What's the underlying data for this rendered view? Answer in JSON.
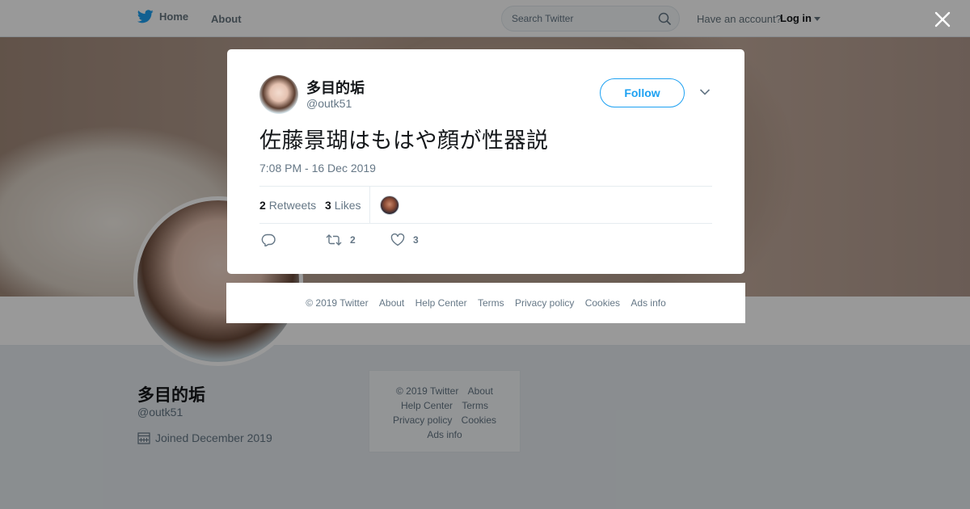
{
  "topbar": {
    "home_label": "Home",
    "about_label": "About",
    "search_placeholder": "Search Twitter",
    "have_account": "Have an account?",
    "login_label": "Log in"
  },
  "profile": {
    "name": "多目的垢",
    "handle": "@outk51",
    "joined": "Joined December 2019"
  },
  "side_footer": {
    "rows": [
      [
        "© 2019 Twitter",
        "About"
      ],
      [
        "Help Center",
        "Terms"
      ],
      [
        "Privacy policy",
        "Cookies"
      ],
      [
        "Ads info"
      ]
    ]
  },
  "tweet": {
    "name": "多目的垢",
    "handle": "@outk51",
    "follow_label": "Follow",
    "text": "佐藤景瑚はもはや顔が性器説",
    "time": "7:08 PM - 16 Dec 2019",
    "retweets_count": "2",
    "retweets_label": "Retweets",
    "likes_count": "3",
    "likes_label": "Likes",
    "action_retweet_count": "2",
    "action_like_count": "3"
  },
  "modal_footer": [
    "© 2019 Twitter",
    "About",
    "Help Center",
    "Terms",
    "Privacy policy",
    "Cookies",
    "Ads info"
  ],
  "colors": {
    "brand_blue": "#1da1f2",
    "overlay": "rgba(0,0,0,0.40)"
  },
  "icons": [
    "twitter-bird-icon",
    "search-icon",
    "caret-down-icon",
    "close-icon",
    "chevron-down-icon",
    "calendar-icon",
    "reply-icon",
    "retweet-icon",
    "heart-icon"
  ]
}
